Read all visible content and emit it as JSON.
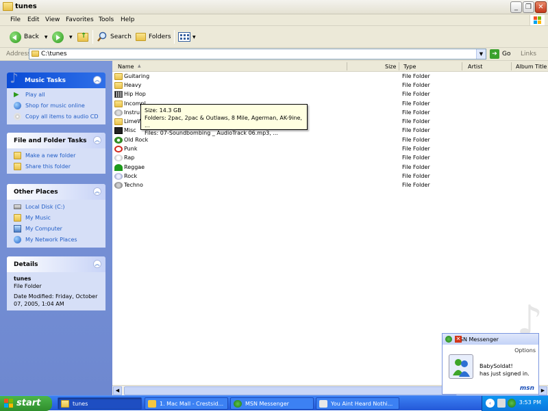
{
  "window": {
    "title": "tunes"
  },
  "menu": [
    "File",
    "Edit",
    "View",
    "Favorites",
    "Tools",
    "Help"
  ],
  "toolbar": {
    "back": "Back",
    "search": "Search",
    "folders": "Folders"
  },
  "address": {
    "label": "Address",
    "value": "C:\\tunes",
    "go": "Go",
    "links": "Links"
  },
  "columns": {
    "name": "Name",
    "size": "Size",
    "type": "Type",
    "artist": "Artist",
    "album": "Album Title"
  },
  "files": [
    {
      "name": "Guitaring",
      "type": "File Folder"
    },
    {
      "name": "Heavy",
      "type": "File Folder"
    },
    {
      "name": "Hip Hop",
      "type": "File Folder"
    },
    {
      "name": "Incompl",
      "type": "File Folder"
    },
    {
      "name": "Instru",
      "type": "File Folder"
    },
    {
      "name": "LimeW",
      "type": "File Folder"
    },
    {
      "name": "Misc",
      "type": "File Folder"
    },
    {
      "name": "Old Rock",
      "type": "File Folder"
    },
    {
      "name": "Punk",
      "type": "File Folder"
    },
    {
      "name": "Rap",
      "type": "File Folder"
    },
    {
      "name": "Reggae",
      "type": "File Folder"
    },
    {
      "name": "Rock",
      "type": "File Folder"
    },
    {
      "name": "Techno",
      "type": "File Folder"
    }
  ],
  "tooltip": {
    "size": "Size: 14.3 GB",
    "folders": "Folders: 2pac, 2pac & Outlaws, 8 Mile, Agerman, AK-9ine, ...",
    "files": "Files: 07-Soundbombing _ AudioTrack 06.mp3, ..."
  },
  "music_tasks": {
    "title": "Music Tasks",
    "items": [
      "Play all",
      "Shop for music online",
      "Copy all items to audio CD"
    ]
  },
  "file_tasks": {
    "title": "File and Folder Tasks",
    "items": [
      "Make a new folder",
      "Share this folder"
    ]
  },
  "other_places": {
    "title": "Other Places",
    "items": [
      "Local Disk (C:)",
      "My Music",
      "My Computer",
      "My Network Places"
    ]
  },
  "details": {
    "title": "Details",
    "name": "tunes",
    "type": "File Folder",
    "modified": "Date Modified: Friday, October 07, 2005, 1:04 AM"
  },
  "msn": {
    "title": "MSN Messenger",
    "options": "Options",
    "line1": "BabySoldat!",
    "line2": "has just signed in.",
    "logo": "msn"
  },
  "taskbar": {
    "start": "start",
    "tasks": [
      "tunes",
      "1. Mac Mall - Crestsid...",
      "MSN Messenger",
      "You Aint Heard Nothi..."
    ],
    "clock": "3:53 PM"
  }
}
